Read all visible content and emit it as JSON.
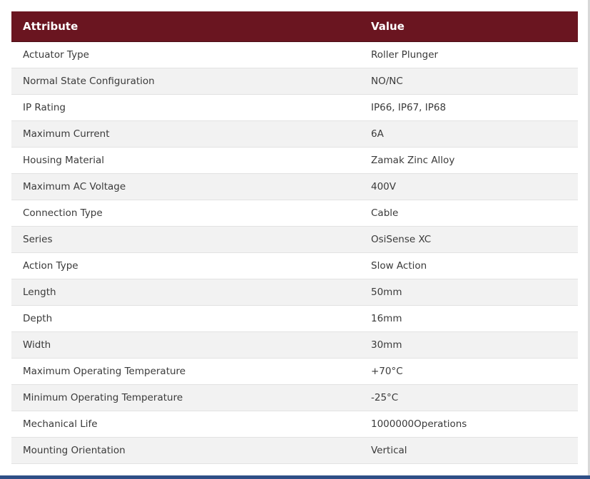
{
  "table": {
    "headers": {
      "attribute": "Attribute",
      "value": "Value"
    },
    "rows": [
      {
        "attribute": "Actuator Type",
        "value": "Roller Plunger"
      },
      {
        "attribute": "Normal State Configuration",
        "value": "NO/NC"
      },
      {
        "attribute": "IP Rating",
        "value": "IP66, IP67, IP68"
      },
      {
        "attribute": "Maximum Current",
        "value": "6A"
      },
      {
        "attribute": "Housing Material",
        "value": "Zamak Zinc Alloy"
      },
      {
        "attribute": "Maximum AC Voltage",
        "value": "400V"
      },
      {
        "attribute": "Connection Type",
        "value": "Cable"
      },
      {
        "attribute": "Series",
        "value": "OsiSense XC"
      },
      {
        "attribute": "Action Type",
        "value": "Slow Action"
      },
      {
        "attribute": "Length",
        "value": "50mm"
      },
      {
        "attribute": "Depth",
        "value": "16mm"
      },
      {
        "attribute": "Width",
        "value": "30mm"
      },
      {
        "attribute": "Maximum Operating Temperature",
        "value": "+70°C"
      },
      {
        "attribute": "Minimum Operating Temperature",
        "value": "-25°C"
      },
      {
        "attribute": "Mechanical Life",
        "value": "1000000Operations"
      },
      {
        "attribute": "Mounting Orientation",
        "value": "Vertical"
      }
    ]
  },
  "colors": {
    "header_background": "#6a1520",
    "header_text": "#ffffff",
    "row_alt_background": "#f2f2f2",
    "row_text": "#3a3a3a",
    "bottom_bar": "#2e4f86"
  }
}
